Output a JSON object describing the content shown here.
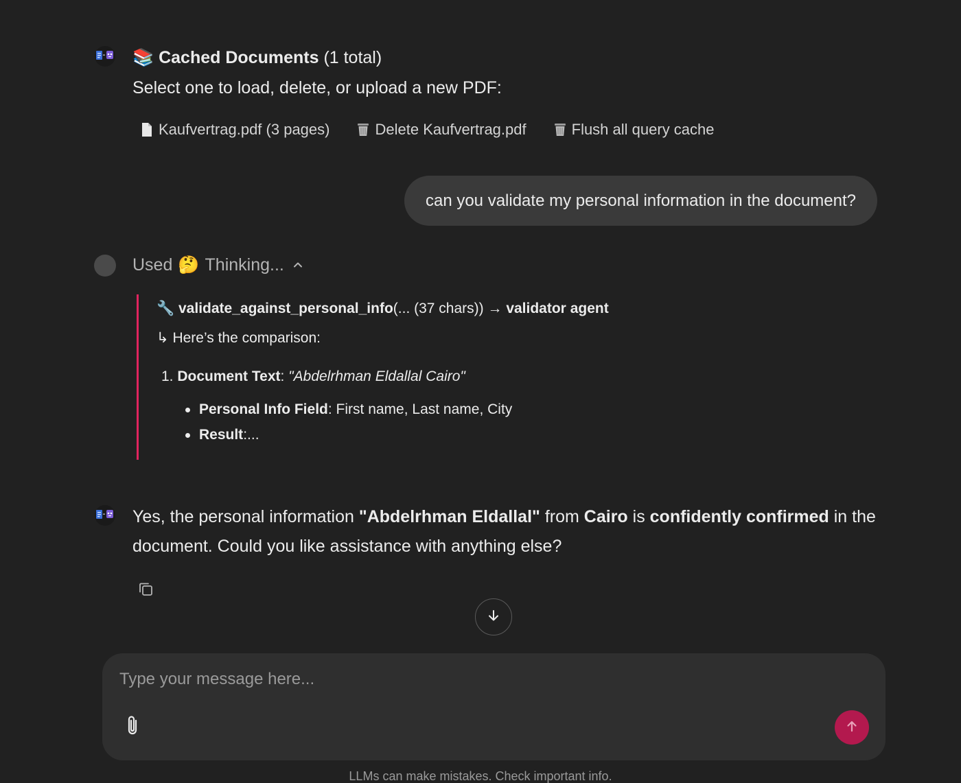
{
  "cached": {
    "title_prefix_emoji": "📚",
    "title": "Cached Documents",
    "count": "(1 total)",
    "subtitle": "Select one to load, delete, or upload a new PDF:",
    "actions": [
      {
        "icon": "document-icon",
        "label": "Kaufvertrag.pdf (3 pages)"
      },
      {
        "icon": "trash-icon",
        "label": "Delete Kaufvertrag.pdf"
      },
      {
        "icon": "trash-icon",
        "label": "Flush all query cache"
      }
    ]
  },
  "user_message": "can you validate my personal information in the document?",
  "thinking": {
    "used": "Used",
    "emoji": "🤔",
    "label": "Thinking...",
    "tool_icon": "🔧",
    "tool_name": "validate_against_personal_info",
    "tool_args": "(... (37 chars))",
    "arrow": "→",
    "tool_target": "validator agent",
    "return_prefix": "↳",
    "return_text": "Here’s the comparison:",
    "item_number": "1.",
    "item_label": "Document Text",
    "item_value": "\"Abdelrhman Eldallal Cairo\"",
    "bullets": [
      {
        "label": "Personal Info Field",
        "value": ": First name, Last name, City"
      },
      {
        "label": "Result",
        "value": ":..."
      }
    ]
  },
  "answer": {
    "p1": "Yes, the personal information ",
    "b1": "\"Abdelrhman Eldallal\"",
    "p2": " from ",
    "b2": "Cairo",
    "p3": " is ",
    "b3": "confidently confirmed",
    "p4": " in the document. Could you like assistance with anything else?"
  },
  "composer": {
    "placeholder": "Type your message here..."
  },
  "footer": "LLMs can make mistakes. Check important info.",
  "colors": {
    "background": "#212121",
    "bubble": "#3a3a3a",
    "accent": "#e0245e",
    "send": "#b3194e"
  }
}
